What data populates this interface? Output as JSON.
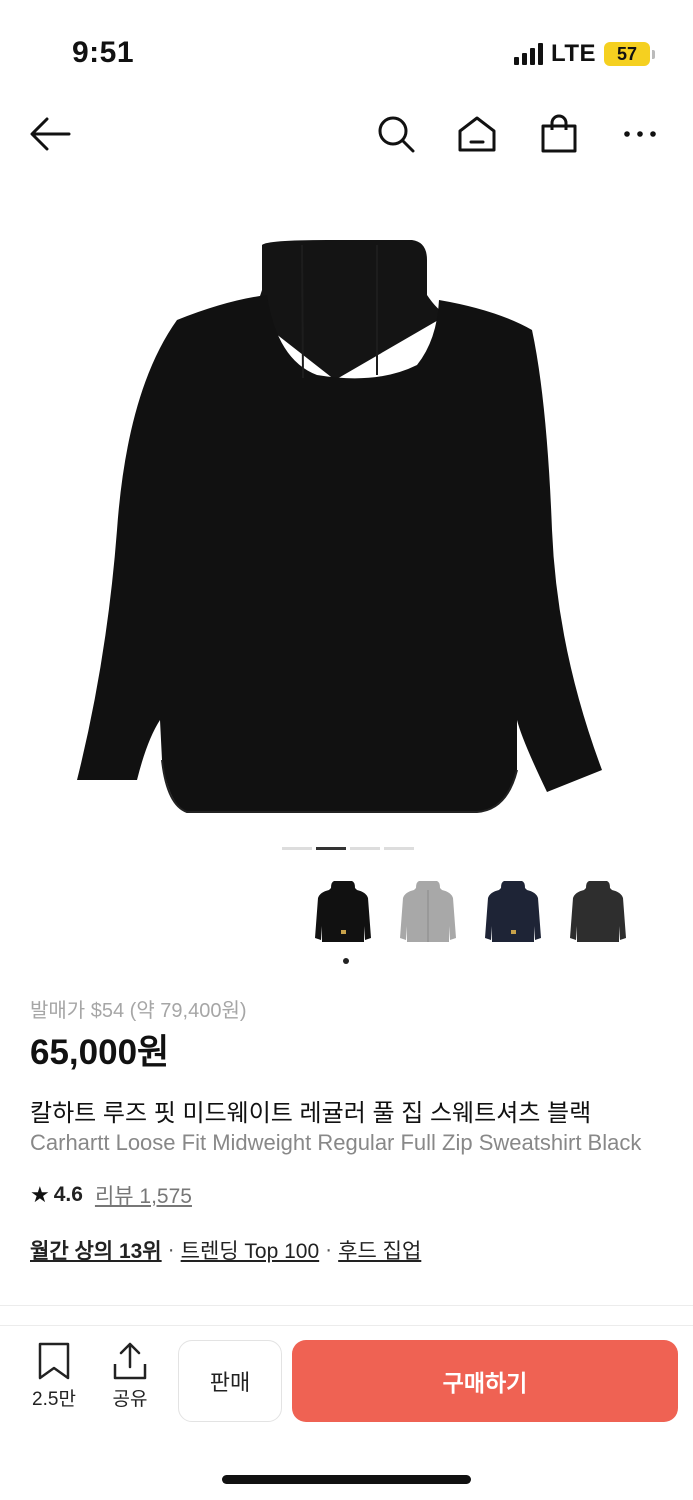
{
  "status_bar": {
    "time": "9:51",
    "network": "LTE",
    "battery": "57"
  },
  "nav": {
    "back_icon": "arrow-left-icon",
    "search_icon": "search-icon",
    "home_icon": "home-icon",
    "bag_icon": "shopping-bag-icon",
    "more_icon": "more-horizontal-icon"
  },
  "carousel": {
    "slide_count": 4,
    "active_index": 1
  },
  "thumbnails": [
    {
      "color": "#111111",
      "name": "black"
    },
    {
      "color": "#a8a8a8",
      "name": "grey"
    },
    {
      "color": "#1e2436",
      "name": "navy"
    },
    {
      "color": "#2e2e2e",
      "name": "charcoal"
    }
  ],
  "product": {
    "release_price": "발매가 $54 (약 79,400원)",
    "price": "65,000원",
    "title_ko": "칼하트 루즈 핏 미드웨이트 레귤러 풀 집 스웨트셔츠 블랙",
    "title_en": "Carhartt Loose Fit Midweight Regular Full Zip Sweatshirt Black",
    "rating": "4.6",
    "reviews": "리뷰 1,575"
  },
  "tags": [
    "월간 상의 13위",
    "트렌딩 Top 100",
    "후드 집업"
  ],
  "tag_separator": "·",
  "actions": {
    "wish_count": "2.5만",
    "share_label": "공유",
    "sell_label": "판매",
    "buy_label": "구매하기"
  },
  "colors": {
    "buy_button": "#ef6253",
    "battery": "#f5d020"
  }
}
